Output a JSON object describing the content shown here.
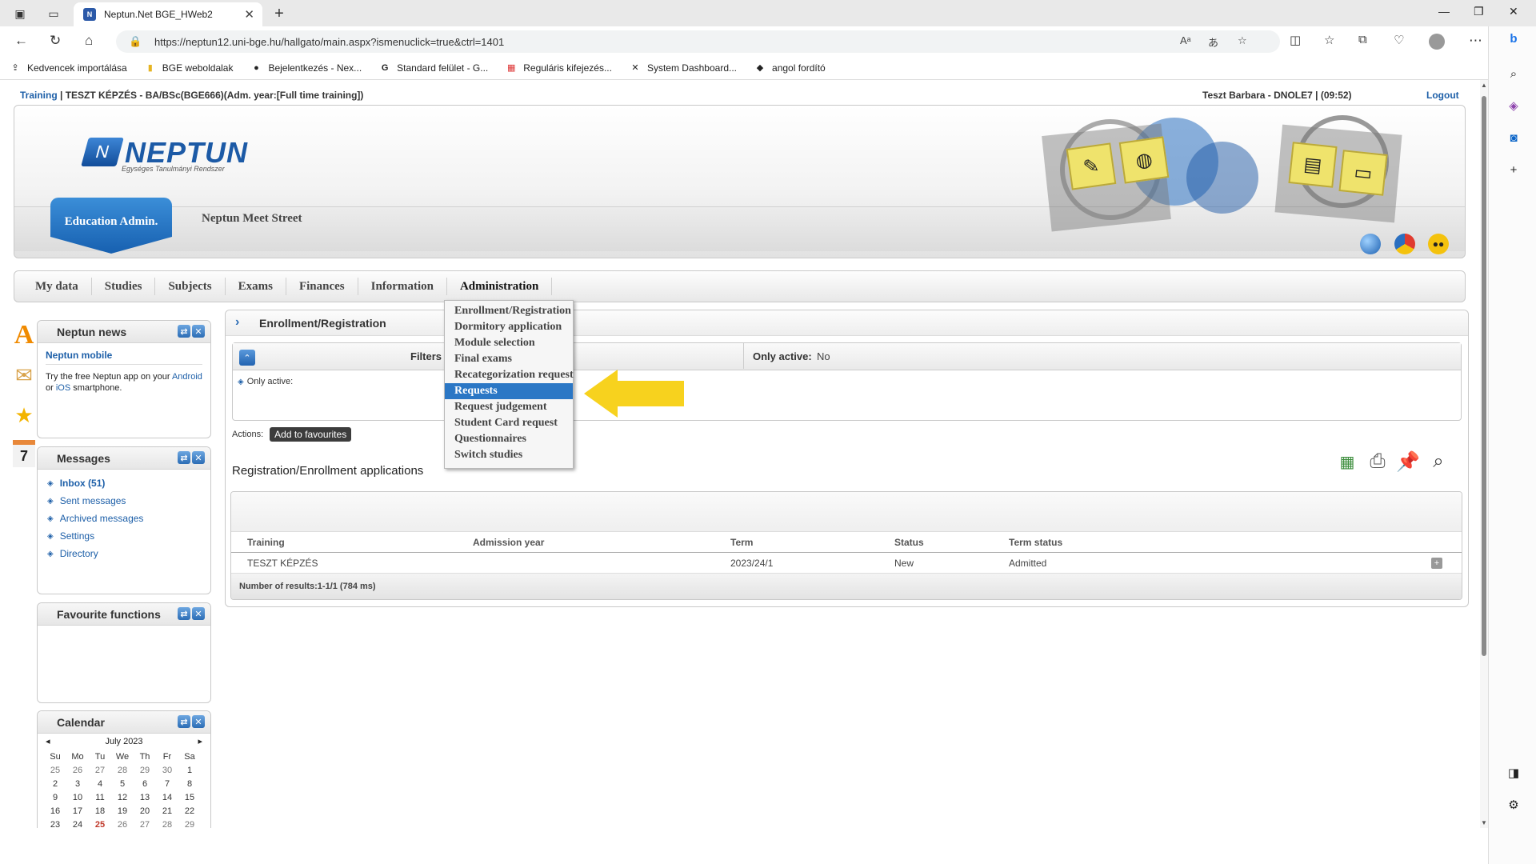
{
  "browser": {
    "tab_title": "Neptun.Net BGE_HWeb2",
    "url": "https://neptun12.uni-bge.hu/hallgato/main.aspx?ismenuclick=true&ctrl=1401",
    "bookmarks": [
      {
        "label": "Kedvencek importálása",
        "icon": "import-icon"
      },
      {
        "label": "BGE weboldalak",
        "icon": "folder-icon"
      },
      {
        "label": "Bejelentkezés - Nex...",
        "icon": "login-icon"
      },
      {
        "label": "Standard felület - G...",
        "icon": "g-icon"
      },
      {
        "label": "Reguláris kifejezés...",
        "icon": "windows-icon"
      },
      {
        "label": "System Dashboard...",
        "icon": "dashboard-icon"
      },
      {
        "label": "angol fordító",
        "icon": "translate-icon"
      }
    ]
  },
  "header": {
    "training_link": "Training",
    "training_separator": "|",
    "training_info": "TESZT KÉPZÉS - BA/BSc(BGE666)(Adm. year:[Full time training])",
    "user": "Teszt Barbara - DNOLE7",
    "user_separator": "|",
    "session_time": "(09:52)",
    "logout": "Logout"
  },
  "banner": {
    "logo_text": "NEPTUN",
    "logo_subtitle": "Egységes Tanulmányi Rendszer",
    "edu_tab": "Education Admin.",
    "meet_street": "Neptun Meet Street"
  },
  "mainnav": {
    "items": [
      "My data",
      "Studies",
      "Subjects",
      "Exams",
      "Finances",
      "Information",
      "Administration"
    ]
  },
  "dropdown": {
    "items": [
      "Enrollment/Registration",
      "Dormitory application",
      "Module selection",
      "Final exams",
      "Recategorization request",
      "Requests",
      "Request judgement",
      "Student Card request",
      "Questionnaires",
      "Switch studies"
    ],
    "selected": "Requests"
  },
  "sidebar": {
    "news": {
      "title": "Neptun news",
      "headline": "Neptun mobile",
      "text_before": "Try the free Neptun app on your",
      "android": "Android",
      "or": "or",
      "ios": "iOS",
      "text_after": "smartphone."
    },
    "messages": {
      "title": "Messages",
      "links": [
        "Inbox (51)",
        "Sent messages",
        "Archived messages",
        "Settings",
        "Directory"
      ]
    },
    "favourites": {
      "title": "Favourite functions"
    },
    "calendar": {
      "title": "Calendar",
      "month": "July 2023",
      "weekdays": [
        "Su",
        "Mo",
        "Tu",
        "We",
        "Th",
        "Fr",
        "Sa"
      ],
      "days": [
        "25",
        "26",
        "27",
        "28",
        "29",
        "30",
        "1",
        "2",
        "3",
        "4",
        "5",
        "6",
        "7",
        "8",
        "9",
        "10",
        "11",
        "12",
        "13",
        "14",
        "15",
        "16",
        "17",
        "18",
        "19",
        "20",
        "21",
        "22",
        "23",
        "24",
        "25",
        "26",
        "27",
        "28",
        "29"
      ]
    }
  },
  "main": {
    "title": "Enrollment/Registration",
    "filters_label": "Filters",
    "only_active_label": "Only active:",
    "only_active_value": "No",
    "only_active_field": "Only active:",
    "actions_label": "Actions:",
    "add_fav": "Add to favourites",
    "list_title": "Registration/Enrollment applications",
    "table": {
      "columns": [
        "Training",
        "Admission year",
        "Term",
        "Status",
        "Term status"
      ],
      "rows": [
        [
          "TESZT KÉPZÉS",
          "",
          "2023/24/1",
          "New",
          "Admitted"
        ]
      ],
      "footer": "Number of results:1-1/1 (784 ms)"
    }
  },
  "colors": {
    "accent": "#2b77c5",
    "highlight_arrow": "#f7d21e",
    "link": "#1d5fa8"
  }
}
